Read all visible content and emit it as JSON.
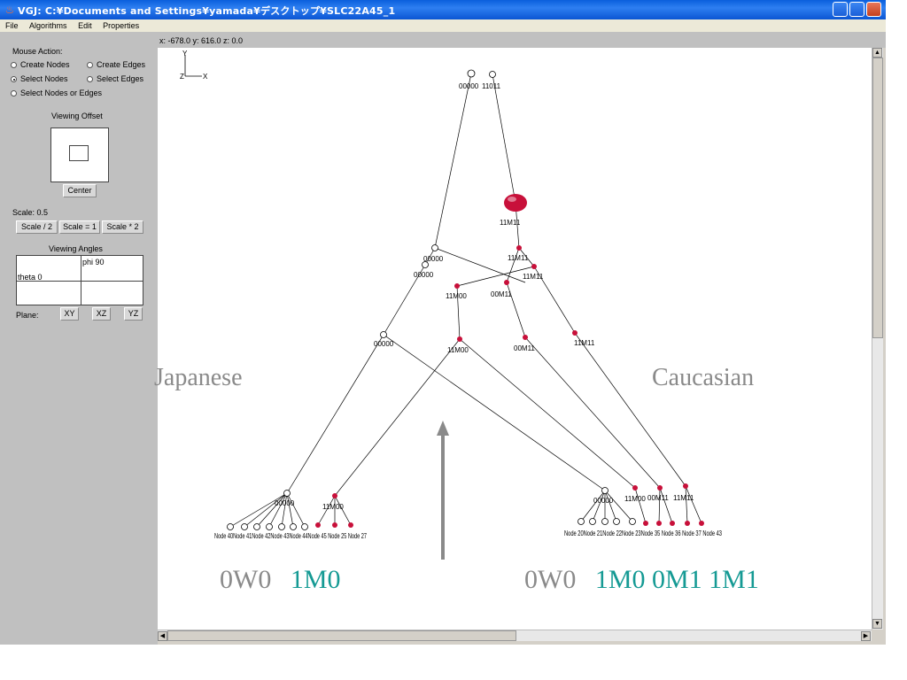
{
  "window": {
    "title": "VGJ:  C:¥Documents and Settings¥yamada¥デスクトップ¥SLC22A45_1"
  },
  "menu": {
    "items": [
      "File",
      "Algorithms",
      "Edit",
      "Properties"
    ]
  },
  "panel": {
    "mouse_action_label": "Mouse Action:",
    "radios": [
      {
        "label": "Create Nodes",
        "checked": false
      },
      {
        "label": "Create Edges",
        "checked": false
      },
      {
        "label": "Select Nodes",
        "checked": true
      },
      {
        "label": "Select Edges",
        "checked": false
      },
      {
        "label": "Select Nodes or Edges",
        "checked": false
      }
    ],
    "viewing_offset_label": "Viewing Offset",
    "center_button": "Center",
    "scale_label": "Scale: 0.5",
    "scale_buttons": [
      "Scale / 2",
      "Scale = 1",
      "Scale * 2"
    ],
    "viewing_angles_label": "Viewing Angles",
    "phi_label": "phi 90",
    "theta_label": "theta 0",
    "plane_label": "Plane:",
    "plane_buttons": [
      "XY",
      "XZ",
      "YZ"
    ]
  },
  "coords": "x: -678.0  y: 616.0  z: 0.0",
  "axes": {
    "y": "Y",
    "z": "Z",
    "x": "X"
  },
  "colors": {
    "selected_node": "#c8103a",
    "open_node": "#ffffff",
    "teal": "#159a94",
    "gray": "#8a8a8a"
  },
  "graph": {
    "nodes": [
      {
        "id": "r1",
        "label": "00000",
        "type": "open"
      },
      {
        "id": "r2",
        "label": "11011",
        "type": "open"
      },
      {
        "id": "big",
        "label": "11M11",
        "type": "big"
      },
      {
        "id": "a1",
        "label": "11M11",
        "type": "red"
      },
      {
        "id": "a2",
        "label": "11M11",
        "type": "red"
      },
      {
        "id": "b1",
        "label": "00000",
        "type": "open"
      },
      {
        "id": "b2",
        "label": "00000",
        "type": "open"
      },
      {
        "id": "c1",
        "label": "11M00",
        "type": "red"
      },
      {
        "id": "c2",
        "label": "00M11",
        "type": "red"
      },
      {
        "id": "d1",
        "label": "00000",
        "type": "open"
      },
      {
        "id": "d2",
        "label": "11M00",
        "type": "red"
      },
      {
        "id": "d3",
        "label": "00M11",
        "type": "red"
      },
      {
        "id": "d4",
        "label": "11M11",
        "type": "red"
      },
      {
        "id": "e1",
        "label": "00000",
        "type": "open"
      },
      {
        "id": "e2",
        "label": "11M00",
        "type": "red"
      },
      {
        "id": "f1",
        "label": "00000",
        "type": "open"
      },
      {
        "id": "f2",
        "label": "11M00",
        "type": "red"
      },
      {
        "id": "f3",
        "label": "00M11",
        "type": "red"
      },
      {
        "id": "f4",
        "label": "11M11",
        "type": "red"
      }
    ],
    "leaf_labels_left": "Node 40Node 41Node 42Node 43Node 44Node 45 Node 25 Node 27",
    "leaf_labels_right": "Node 20Node 21Node 22Node 23Node 35 Node 36 Node 37 Node 43"
  },
  "slide": {
    "japanese": "Japanese",
    "caucasian": "Caucasian",
    "left_gray": "0W0",
    "left_teal": "1M0",
    "right_gray": "0W0",
    "right_teal": "1M0 0M1 1M1"
  }
}
